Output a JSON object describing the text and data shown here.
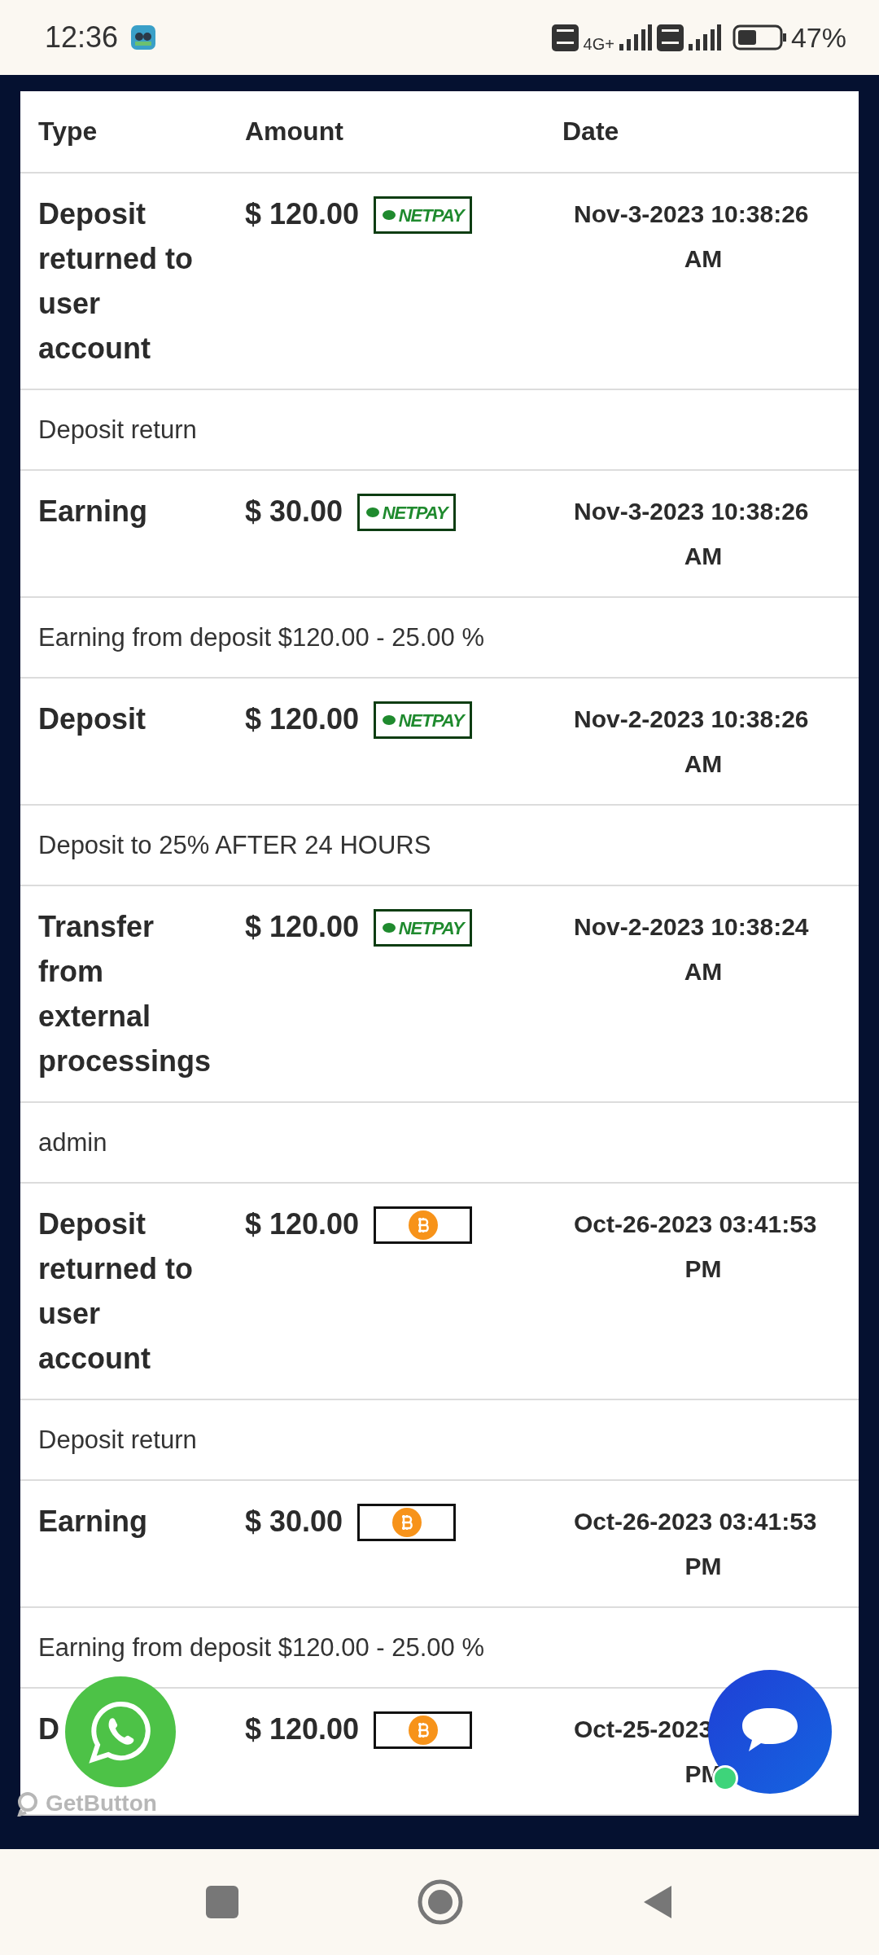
{
  "status_bar": {
    "time": "12:36",
    "network": "4G+",
    "battery": "47%"
  },
  "table": {
    "columns": [
      "Type",
      "Amount",
      "Date"
    ],
    "rows": [
      {
        "type": "Deposit returned to user account",
        "amount": "$ 120.00",
        "method": {
          "kind": "netpay",
          "label": "NETPAY"
        },
        "date_lines": [
          "Nov-3-2023 10:38:26",
          "AM"
        ],
        "description": "Deposit return"
      },
      {
        "type": "Earning",
        "amount": "$ 30.00",
        "method": {
          "kind": "netpay",
          "label": "NETPAY"
        },
        "date_lines": [
          "Nov-3-2023 10:38:26",
          "AM"
        ],
        "description": "Earning from deposit $120.00 - 25.00 %"
      },
      {
        "type": "Deposit",
        "amount": "$ 120.00",
        "method": {
          "kind": "netpay",
          "label": "NETPAY"
        },
        "date_lines": [
          "Nov-2-2023 10:38:26",
          "AM"
        ],
        "description": "Deposit to 25% AFTER 24 HOURS"
      },
      {
        "type": "Transfer from external processings",
        "amount": "$ 120.00",
        "method": {
          "kind": "netpay",
          "label": "NETPAY"
        },
        "date_lines": [
          "Nov-2-2023 10:38:24",
          "AM"
        ],
        "description": "admin"
      },
      {
        "type": "Deposit returned to user account",
        "amount": "$ 120.00",
        "method": {
          "kind": "bitcoin"
        },
        "date_lines": [
          "Oct-26-2023 03:41:53",
          "PM"
        ],
        "description": "Deposit return"
      },
      {
        "type": "Earning",
        "amount": "$ 30.00",
        "method": {
          "kind": "bitcoin"
        },
        "date_lines": [
          "Oct-26-2023 03:41:53",
          "PM"
        ],
        "description": "Earning from deposit $120.00 - 25.00 %"
      },
      {
        "type": "D",
        "amount": "$ 120.00",
        "method": {
          "kind": "bitcoin"
        },
        "date_lines": [
          "Oct-25-2023",
          "PM"
        ]
      }
    ]
  },
  "getbutton": {
    "label": "GetButton"
  }
}
